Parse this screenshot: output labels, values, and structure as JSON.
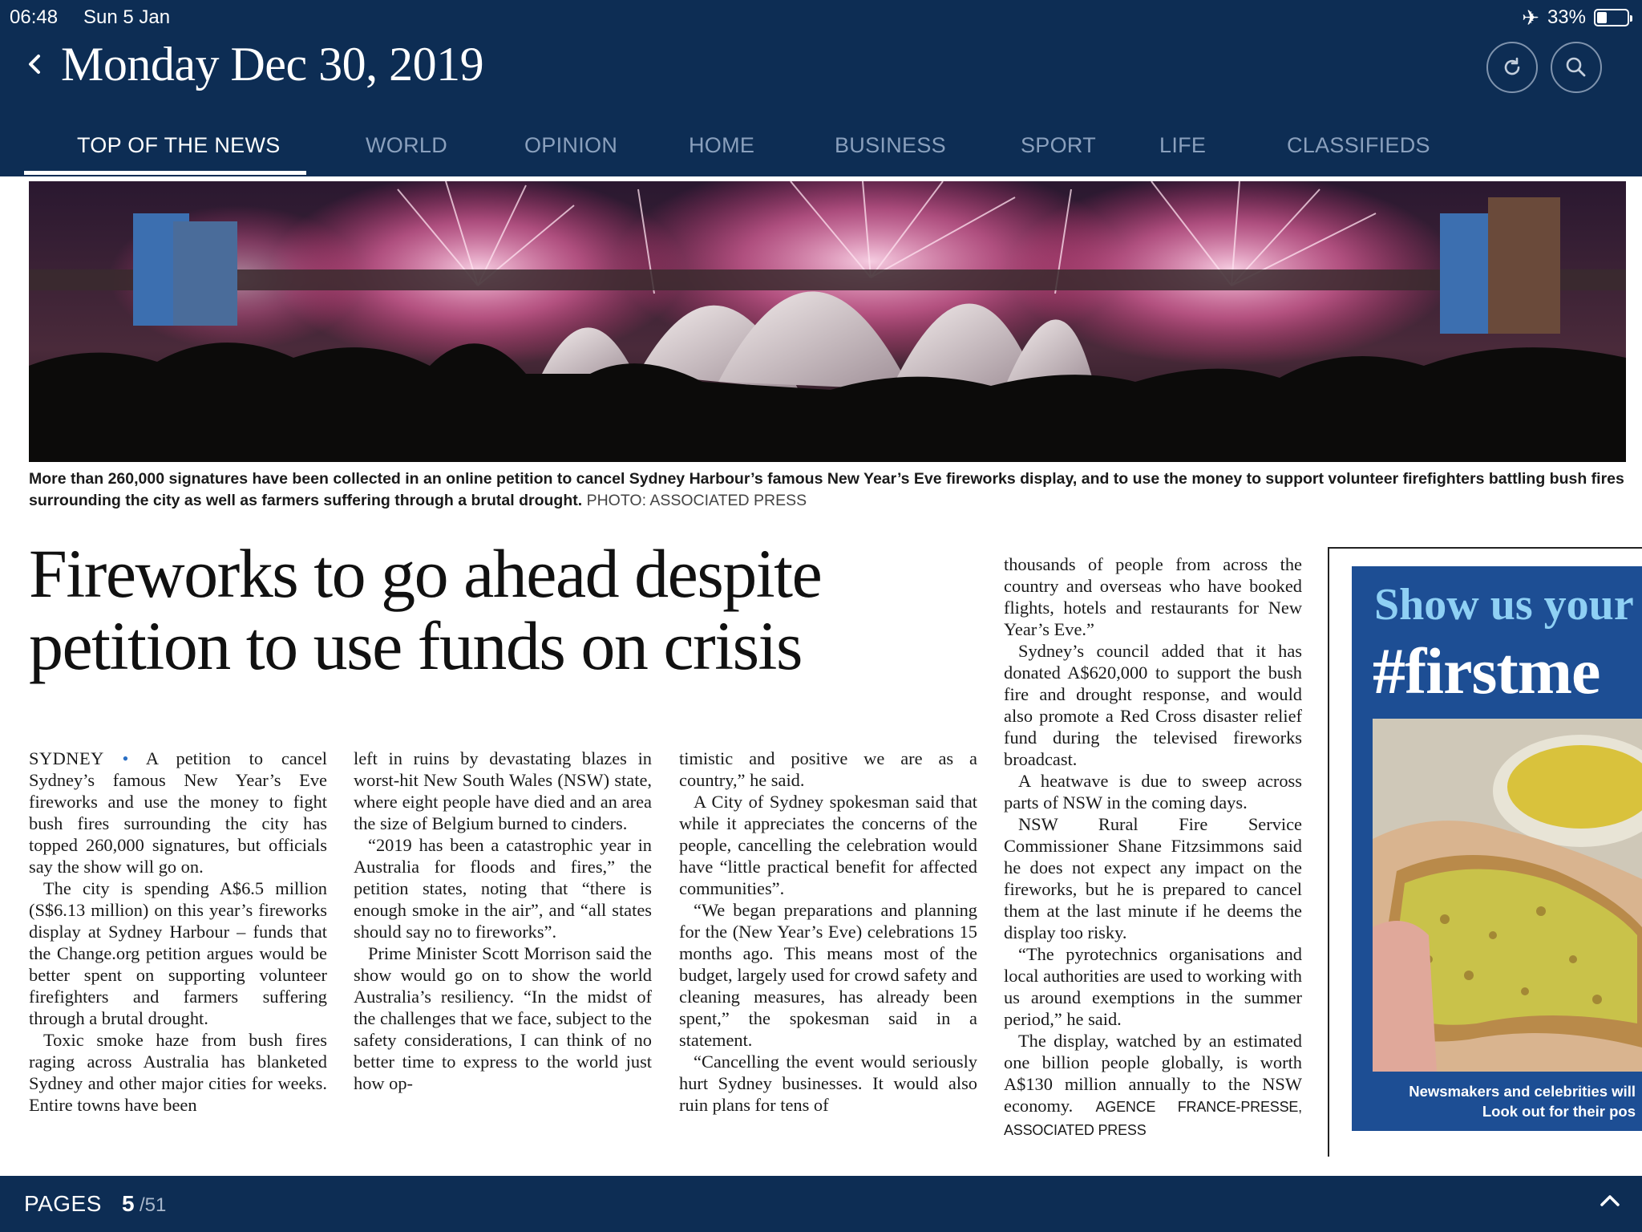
{
  "status_bar": {
    "time": "06:48",
    "date": "Sun 5 Jan",
    "battery": "33%",
    "battery_level": 0.33
  },
  "header": {
    "back_icon": "chevron-left-icon",
    "title": "Monday Dec 30, 2019",
    "refresh_icon": "refresh-icon",
    "search_icon": "search-icon"
  },
  "tabs": [
    {
      "label": "TOP OF THE NEWS",
      "active": true
    },
    {
      "label": "WORLD"
    },
    {
      "label": "OPINION"
    },
    {
      "label": "HOME"
    },
    {
      "label": "BUSINESS"
    },
    {
      "label": "SPORT"
    },
    {
      "label": "LIFE"
    },
    {
      "label": "CLASSIFIEDS"
    }
  ],
  "article": {
    "caption": "More than 260,000 signatures have been collected in an online petition to cancel Sydney Harbour’s famous New Year’s Eve fireworks display, and to use the money to support volunteer firefighters battling bush fires surrounding the city as well as farmers suffering through a brutal drought.",
    "caption_credit": "PHOTO: ASSOCIATED PRESS",
    "headline": "Fireworks to go ahead despite petition to use funds on crisis",
    "dateline": "SYDNEY",
    "col1": [
      "A petition to cancel Sydney’s famous New Year’s Eve fireworks and use the money to fight bush fires surrounding the city has topped 260,000 signatures, but officials say the show will go on.",
      "The city is spending A$6.5 million (S$6.13 million) on this year’s fireworks display at Sydney Harbour – funds that the Change.org petition argues would be better spent on supporting volunteer firefighters and farmers suffering through a brutal drought.",
      "Toxic smoke haze from bush fires raging across Australia has blanketed Sydney and other major cities for weeks. Entire towns have been"
    ],
    "col2": [
      "left in ruins by devastating blazes in worst-hit New South Wales (NSW) state, where eight people have died and an area the size of Belgium burned to cinders.",
      "“2019 has been a catastrophic year in Australia for floods and fires,” the petition states, noting that “there is enough smoke in the air”, and “all states should say no to fireworks”.",
      "Prime Minister Scott Morrison said the show would go on to show the world Australia’s resiliency. “In the midst of the challenges that we face, subject to the safety considerations, I can think of no better time to express to the world just how op-"
    ],
    "col3": [
      "timistic and positive we are as a country,” he said.",
      "A City of Sydney spokesman said that while it appreciates the concerns of the people, cancelling the celebration would have “little practical benefit for affected communities”.",
      "“We began preparations and planning for the (New Year’s Eve) celebrations 15 months ago. This means most of the budget, largely used for crowd safety and cleaning measures, has already been spent,” the spokesman said in a statement.",
      "“Cancelling the event would seriously hurt Sydney businesses. It would also ruin plans for tens of"
    ],
    "col4": [
      "thousands of people from across the country and overseas who have booked flights, hotels and restaurants for New Year’s Eve.”",
      "Sydney’s council added that it has donated A$620,000 to support the bush fire and drought response, and would also promote a Red Cross disaster relief fund during the televised fireworks broadcast.",
      "A heatwave is due to sweep across parts of NSW in the coming days.",
      "NSW Rural Fire Service Commissioner Shane Fitzsimmons said he does not expect any impact on the fireworks, but he is prepared to cancel them at the last minute if he deems the display too risky.",
      "“The pyrotechnics organisations and local authorities are used to working with us around exemptions in the summer period,” he said."
    ],
    "col4_last": "The display, watched by an estimated one billion people globally, is worth A$130 million annually to the NSW economy.",
    "agency": "AGENCE FRANCE-PRESSE, ASSOCIATED PRESS"
  },
  "ad": {
    "line1": "Show us your",
    "line2": "#firstme",
    "note1": "Newsmakers and celebrities will",
    "note2": "Look out for their pos"
  },
  "bottom_bar": {
    "pages_label": "PAGES",
    "current_page": "5",
    "total_pages": "/51",
    "up_icon": "chevron-up-icon"
  },
  "colors": {
    "brand_navy": "#0d2d54",
    "tab_inactive": "#8aa0bd",
    "ad_blue": "#1d4e94",
    "ad_light_blue": "#8fd0f4"
  }
}
